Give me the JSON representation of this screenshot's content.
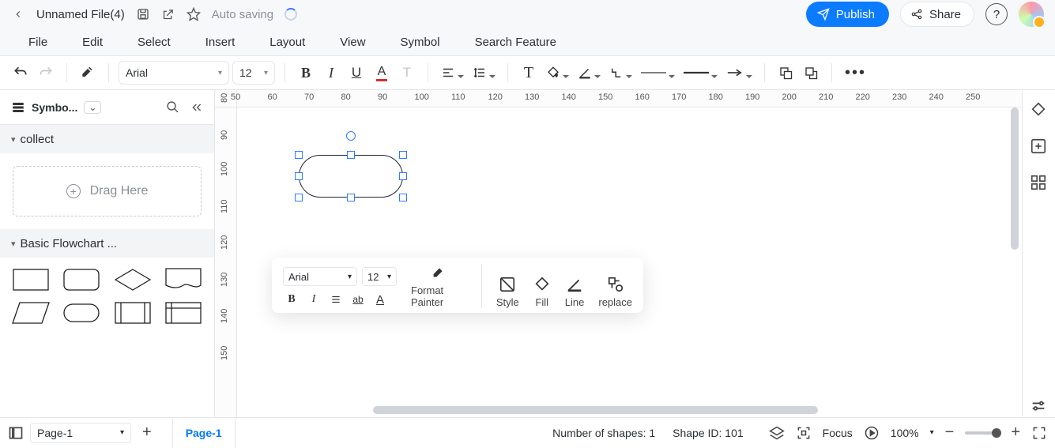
{
  "title_bar": {
    "file_name": "Unnamed File(4)",
    "auto_saving": "Auto saving",
    "publish": "Publish",
    "share": "Share"
  },
  "menu": {
    "file": "File",
    "edit": "Edit",
    "select": "Select",
    "insert": "Insert",
    "layout": "Layout",
    "view": "View",
    "symbol": "Symbol",
    "search": "Search Feature"
  },
  "toolbar": {
    "font": "Arial",
    "size": "12"
  },
  "sidebar": {
    "title": "Symbo...",
    "collect": "collect",
    "drag_here": "Drag Here",
    "basic": "Basic Flowchart ..."
  },
  "floatbar": {
    "font": "Arial",
    "size": "12",
    "format_painter": "Format Painter",
    "style": "Style",
    "fill": "Fill",
    "line": "Line",
    "replace": "replace"
  },
  "h_ruler": [
    "50",
    "60",
    "70",
    "80",
    "90",
    "100",
    "110",
    "120",
    "130",
    "140",
    "150",
    "160",
    "170",
    "180",
    "190",
    "200",
    "210",
    "220",
    "230",
    "240",
    "250"
  ],
  "v_ruler": [
    "80",
    "90",
    "100",
    "110",
    "120",
    "130",
    "140",
    "150"
  ],
  "status": {
    "page_select": "Page-1",
    "page_tab": "Page-1",
    "shapes": "Number of shapes: 1",
    "shape_id": "Shape ID: 101",
    "focus": "Focus",
    "zoom": "100%"
  }
}
